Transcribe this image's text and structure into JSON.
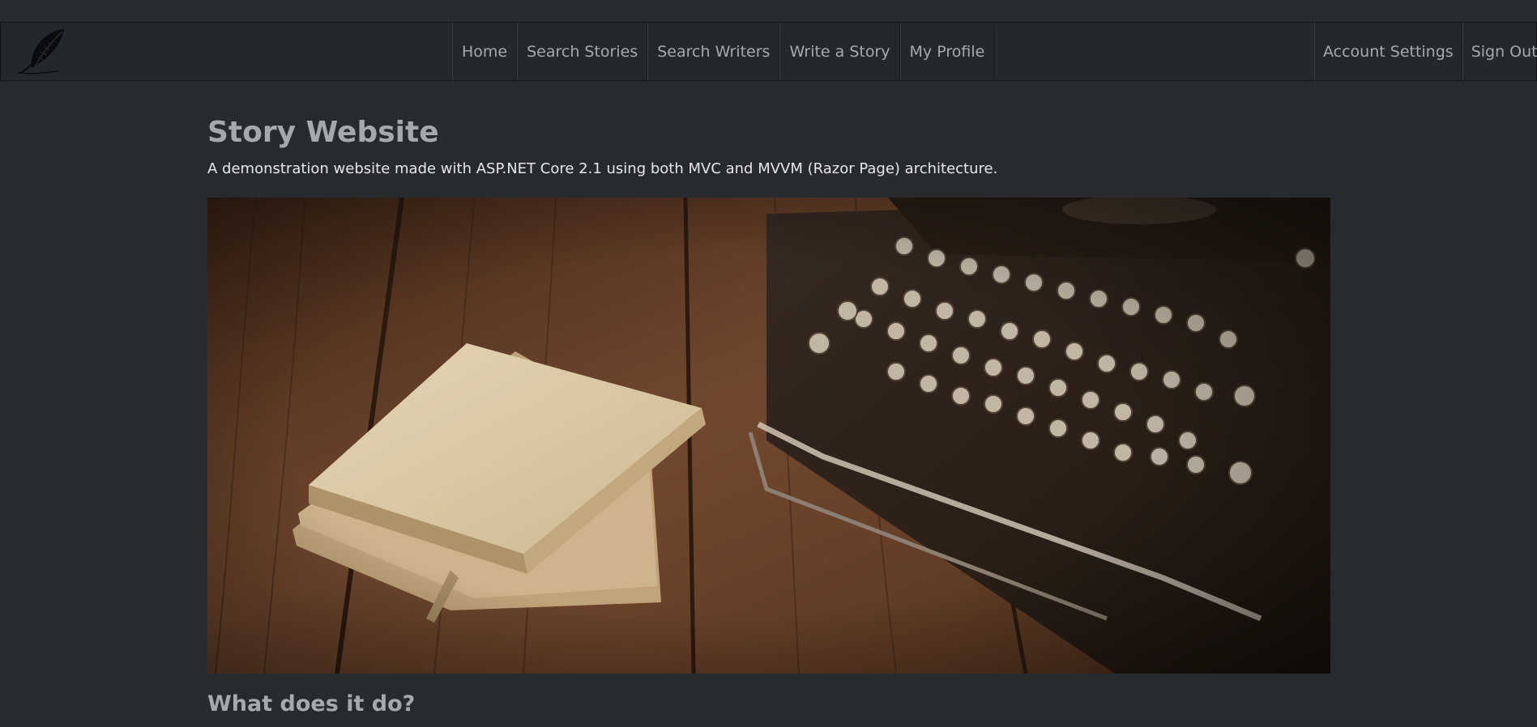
{
  "nav": {
    "center_items": [
      {
        "label": "Home"
      },
      {
        "label": "Search Stories"
      },
      {
        "label": "Search Writers"
      },
      {
        "label": "Write a Story"
      },
      {
        "label": "My Profile"
      }
    ],
    "right_items": [
      {
        "label": "Account Settings"
      },
      {
        "label": "Sign Out"
      }
    ],
    "logo_icon": "feather-quill-icon"
  },
  "main": {
    "title": "Story Website",
    "subtitle": "A demonstration website made with ASP.NET Core 2.1 using both MVC and MVVM (Razor Page) architecture.",
    "section_heading": "What does it do?",
    "hero_image": "typewriter-and-books-photo"
  },
  "colors": {
    "background": "#272b30",
    "navbar": "#24282d",
    "nav_text": "#a5a9ae",
    "heading_text": "#a5a9ae",
    "body_text": "#e6e6e6"
  }
}
